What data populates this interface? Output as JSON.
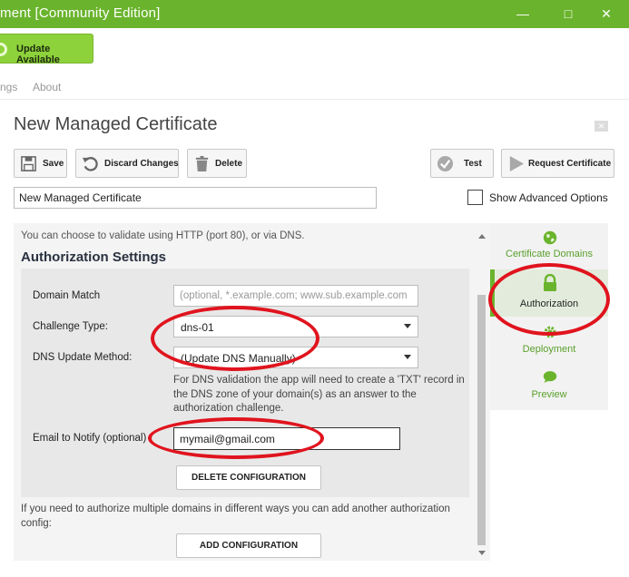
{
  "window": {
    "title": "ment [Community Edition]",
    "minimize": "—",
    "maximize": "□",
    "close": "✕"
  },
  "update": {
    "label": "Update Available"
  },
  "menu": {
    "items": [
      "ngs",
      "About"
    ]
  },
  "page": {
    "title": "New Managed Certificate",
    "close": "✕"
  },
  "toolbar": {
    "save": "Save",
    "discard": "Discard Changes",
    "delete": "Delete",
    "test": "Test",
    "request": "Request Certificate"
  },
  "name_field": {
    "value": "New Managed Certificate"
  },
  "advanced": {
    "label": "Show Advanced Options",
    "checked": false
  },
  "auth": {
    "intro": "You can choose to validate using HTTP (port 80), or via DNS.",
    "section_title": "Authorization Settings",
    "domain_match": {
      "label": "Domain Match",
      "placeholder": "(optional, *.example.com; www.sub.example.com"
    },
    "challenge_type": {
      "label": "Challenge Type:",
      "value": "dns-01"
    },
    "dns_method": {
      "label": "DNS Update Method:",
      "value": "(Update DNS Manually)"
    },
    "dns_help": "For DNS validation the app will need to create a 'TXT' record in the DNS zone of your domain(s) as an answer to the authorization challenge.",
    "email": {
      "label": "Email to Notify (optional)",
      "value": "mymail@gmail.com"
    },
    "delete_config": "DELETE CONFIGURATION",
    "multi_note": "If you need to authorize multiple domains in different ways you can add another authorization config:",
    "add_config": "ADD CONFIGURATION"
  },
  "nav": {
    "items": [
      {
        "label": "Certificate Domains",
        "icon": "globe-icon"
      },
      {
        "label": "Authorization",
        "icon": "lock-icon",
        "active": true
      },
      {
        "label": "Deployment",
        "icon": "gear-icon"
      },
      {
        "label": "Preview",
        "icon": "speech-bubble-icon"
      }
    ]
  },
  "colors": {
    "accent": "#6ab42d",
    "update": "#8ed23b",
    "highlight": "#e0141e",
    "nav_text": "#5aa02c"
  }
}
